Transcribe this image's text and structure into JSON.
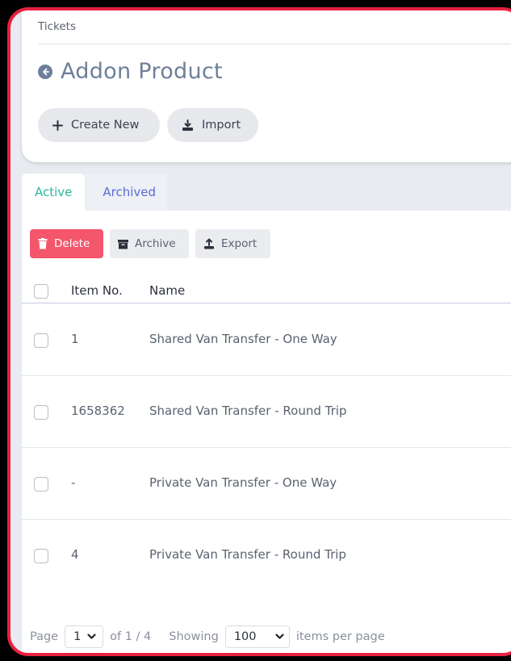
{
  "breadcrumb": "Tickets",
  "page_title": "Addon Product",
  "header_buttons": {
    "create_new": "Create New",
    "import": "Import"
  },
  "tabs": [
    {
      "label": "Active",
      "active": true
    },
    {
      "label": "Archived",
      "active": false
    }
  ],
  "actions": {
    "delete": "Delete",
    "archive": "Archive",
    "export": "Export"
  },
  "table": {
    "columns": [
      "Item No.",
      "Name"
    ],
    "rows": [
      {
        "item_no": "1",
        "name": "Shared Van Transfer - One Way"
      },
      {
        "item_no": "1658362",
        "name": "Shared Van Transfer - Round Trip"
      },
      {
        "item_no": "-",
        "name": "Private Van Transfer - One Way"
      },
      {
        "item_no": "4",
        "name": "Private Van Transfer - Round Trip"
      }
    ]
  },
  "pagination": {
    "page_label": "Page",
    "page_value": "1",
    "of_label": "of 1 / 4",
    "showing_label": "Showing",
    "per_page_value": "100",
    "per_page_suffix": "items per page"
  },
  "colors": {
    "frame": "#e8213f",
    "delete": "#f4566c",
    "active_tab": "#2eb79a",
    "inactive_tab": "#5a6bd8",
    "title": "#6d7f99"
  }
}
